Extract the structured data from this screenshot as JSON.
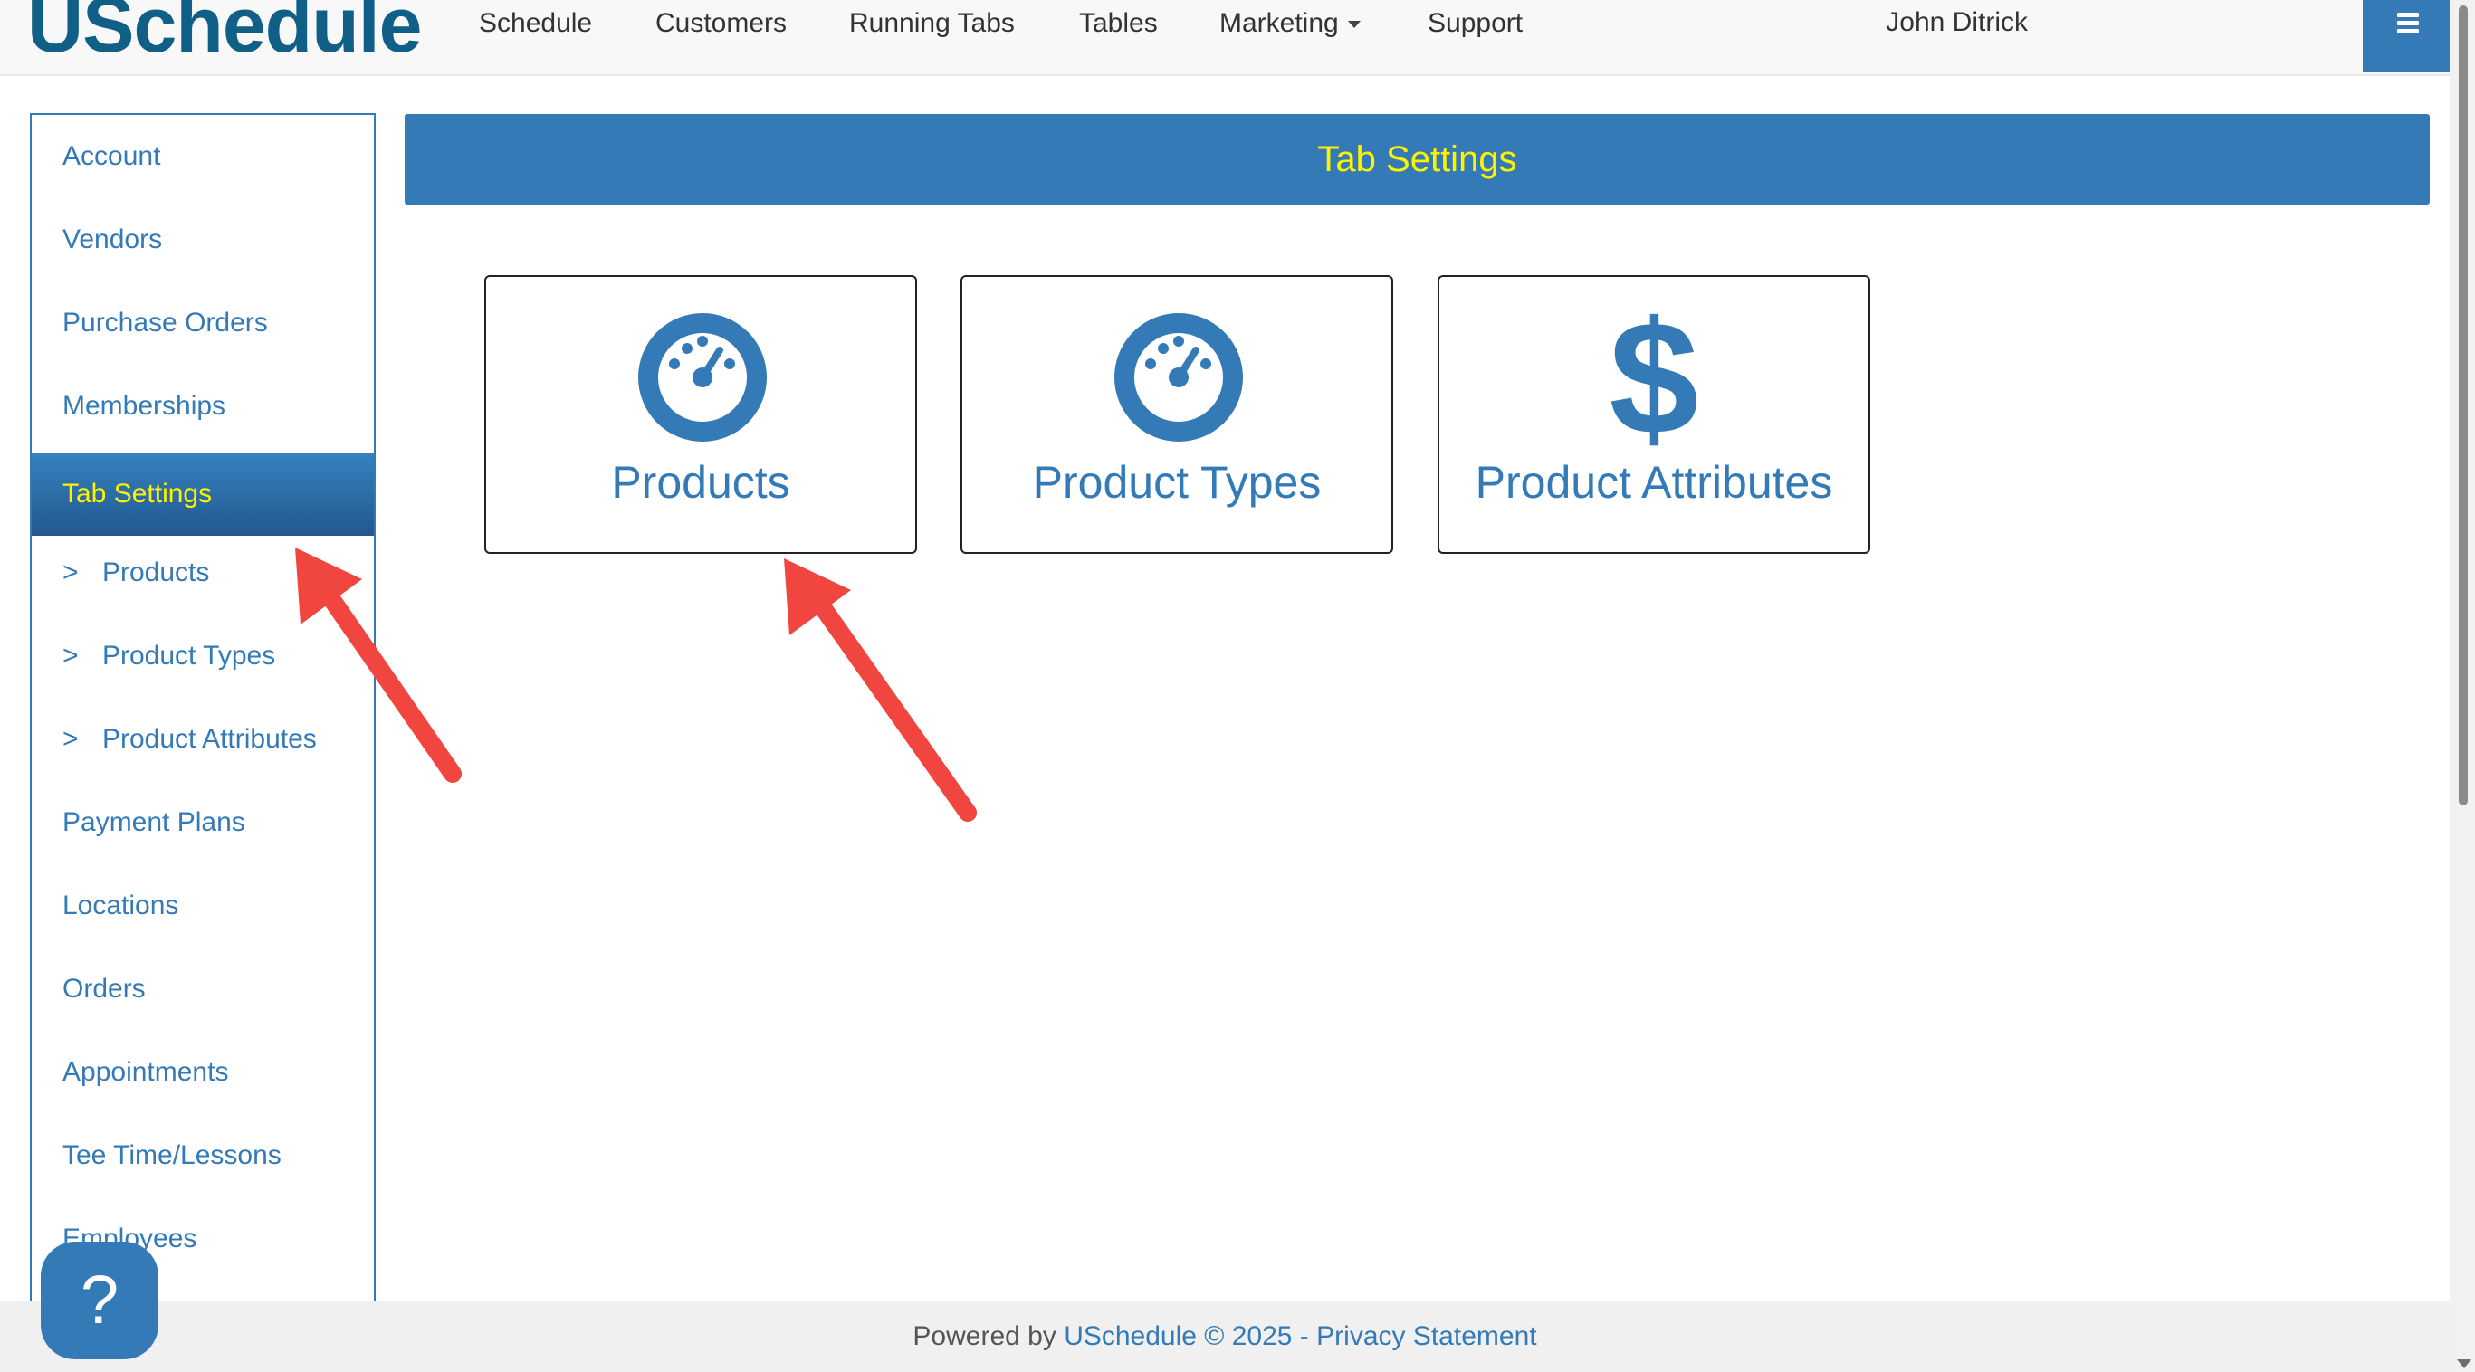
{
  "brand": "USchedule",
  "nav": {
    "items": [
      "Schedule",
      "Customers",
      "Running Tabs",
      "Tables",
      "Marketing",
      "Support"
    ],
    "user": "John Ditrick"
  },
  "sidebar": {
    "items": [
      {
        "label": "Account"
      },
      {
        "label": "Vendors"
      },
      {
        "label": "Purchase Orders"
      },
      {
        "label": "Memberships"
      },
      {
        "label": "Tab Settings",
        "active": true
      },
      {
        "label": "Products",
        "sub": true
      },
      {
        "label": "Product Types",
        "sub": true
      },
      {
        "label": "Product Attributes",
        "sub": true
      },
      {
        "label": "Payment Plans"
      },
      {
        "label": "Locations"
      },
      {
        "label": "Orders"
      },
      {
        "label": "Appointments"
      },
      {
        "label": "Tee Time/Lessons"
      },
      {
        "label": "Employees"
      }
    ],
    "sub_marker": ">"
  },
  "main": {
    "title": "Tab Settings",
    "cards": [
      {
        "label": "Products",
        "icon": "dashboard-icon"
      },
      {
        "label": "Product Types",
        "icon": "dashboard-icon"
      },
      {
        "label": "Product Attributes",
        "icon": "dollar-icon",
        "glyph": "$"
      }
    ]
  },
  "footer": {
    "prefix": "Powered by",
    "brand_link": "USchedule",
    "copyright": "© 2025 -",
    "privacy": "Privacy Statement"
  },
  "help": {
    "glyph": "?"
  },
  "colors": {
    "accent": "#337ab7",
    "active_text": "#fff200",
    "brand": "#0f5f86",
    "annotation_arrow": "#f0463f"
  }
}
